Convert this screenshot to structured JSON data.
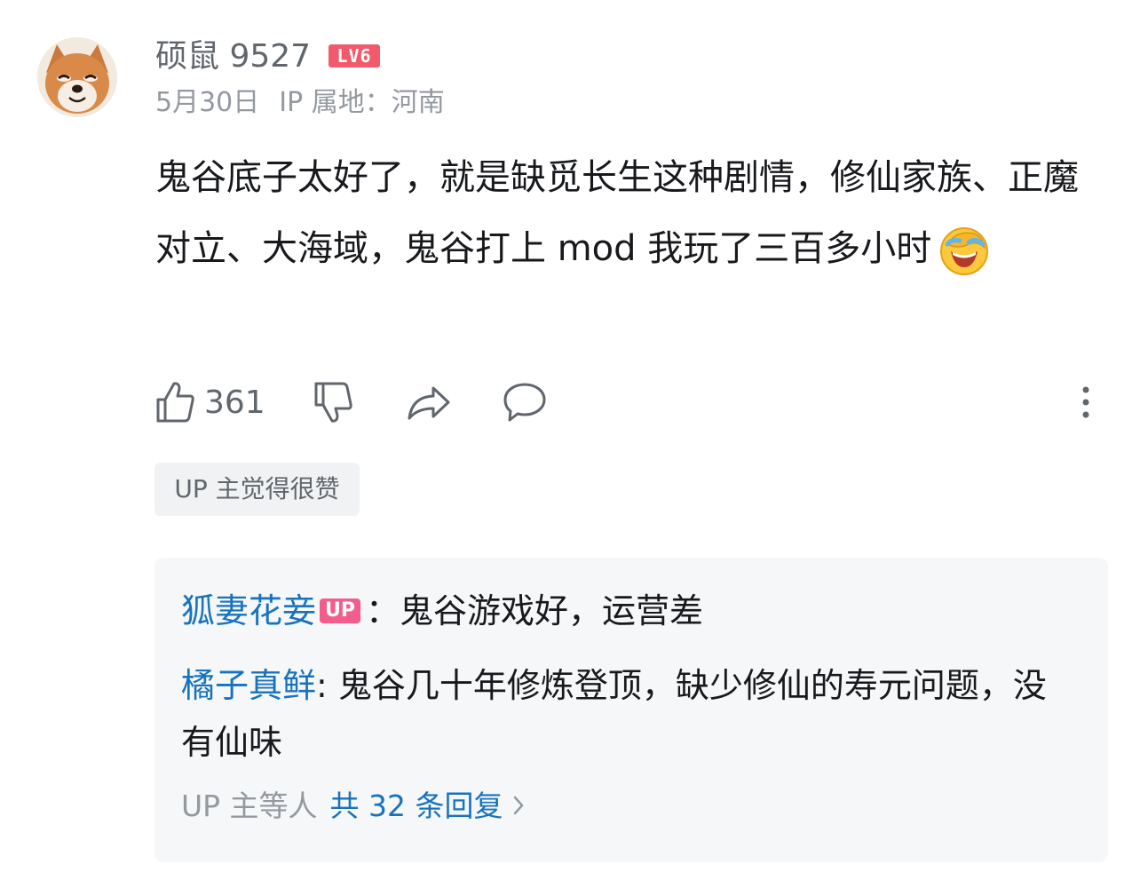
{
  "user": {
    "name": "硕鼠 9527",
    "level_badge": "LV6",
    "date": "5月30日",
    "ip_location": "IP 属地：河南"
  },
  "comment": {
    "text": "鬼谷底子太好了，就是缺觅长生这种剧情，修仙家族、正魔对立、大海域，鬼谷打上 mod 我玩了三百多小时",
    "emoji": "facepalm-laugh-emoji"
  },
  "actions": {
    "like_count": "361"
  },
  "tag": {
    "label": "UP 主觉得很赞"
  },
  "replies": [
    {
      "author": "狐妻花妾",
      "badge": "UP",
      "separator": "：",
      "text": "鬼谷游戏好，运营差"
    },
    {
      "author": "橘子真鲜",
      "separator": ": ",
      "text": "鬼谷几十年修炼登顶，缺少修仙的寿元问题，没有仙味"
    }
  ],
  "reply_summary": {
    "prefix": "UP 主等人",
    "count_label": "共 32 条回复"
  },
  "colors": {
    "link": "#1773bd",
    "muted": "#9499a0",
    "level_badge": "#f2596a",
    "up_badge": "#f25d8e",
    "reply_bg": "#f6f7f8"
  },
  "icons": [
    "thumbs-up-icon",
    "thumbs-down-icon",
    "share-icon",
    "comment-icon",
    "more-vertical-icon",
    "chevron-right-icon"
  ]
}
